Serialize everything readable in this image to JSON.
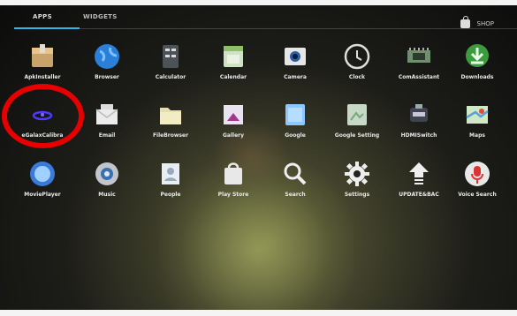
{
  "tabs": {
    "apps": "APPS",
    "widgets": "WIDGETS",
    "shop": "SHOP"
  },
  "apps": [
    {
      "label": "ApkInstaller",
      "icon": "apk-installer-icon"
    },
    {
      "label": "Browser",
      "icon": "globe-icon"
    },
    {
      "label": "Calculator",
      "icon": "calculator-icon"
    },
    {
      "label": "Calendar",
      "icon": "calendar-icon"
    },
    {
      "label": "Camera",
      "icon": "camera-icon"
    },
    {
      "label": "Clock",
      "icon": "clock-icon"
    },
    {
      "label": "ComAssistant",
      "icon": "circuit-board-icon"
    },
    {
      "label": "Downloads",
      "icon": "download-icon"
    },
    {
      "label": "eGalaxCalibra",
      "icon": "touch-calibration-icon"
    },
    {
      "label": "Email",
      "icon": "envelope-icon"
    },
    {
      "label": "FileBrowser",
      "icon": "folder-icon"
    },
    {
      "label": "Gallery",
      "icon": "gallery-icon"
    },
    {
      "label": "Google",
      "icon": "google-search-icon"
    },
    {
      "label": "Google Setting",
      "icon": "google-settings-icon"
    },
    {
      "label": "HDMISwitch",
      "icon": "hdmi-switch-icon"
    },
    {
      "label": "Maps",
      "icon": "map-icon"
    },
    {
      "label": "MoviePlayer",
      "icon": "movie-player-icon"
    },
    {
      "label": "Music",
      "icon": "music-speaker-icon"
    },
    {
      "label": "People",
      "icon": "contacts-icon"
    },
    {
      "label": "Play Store",
      "icon": "shopping-bag-icon"
    },
    {
      "label": "Search",
      "icon": "magnifier-icon"
    },
    {
      "label": "Settings",
      "icon": "gear-icon"
    },
    {
      "label": "UPDATE&BAC",
      "icon": "update-arrow-icon"
    },
    {
      "label": "Voice Search",
      "icon": "microphone-icon"
    }
  ],
  "colors": {
    "accent": "#33b5e5",
    "annotation": "#e60000"
  }
}
